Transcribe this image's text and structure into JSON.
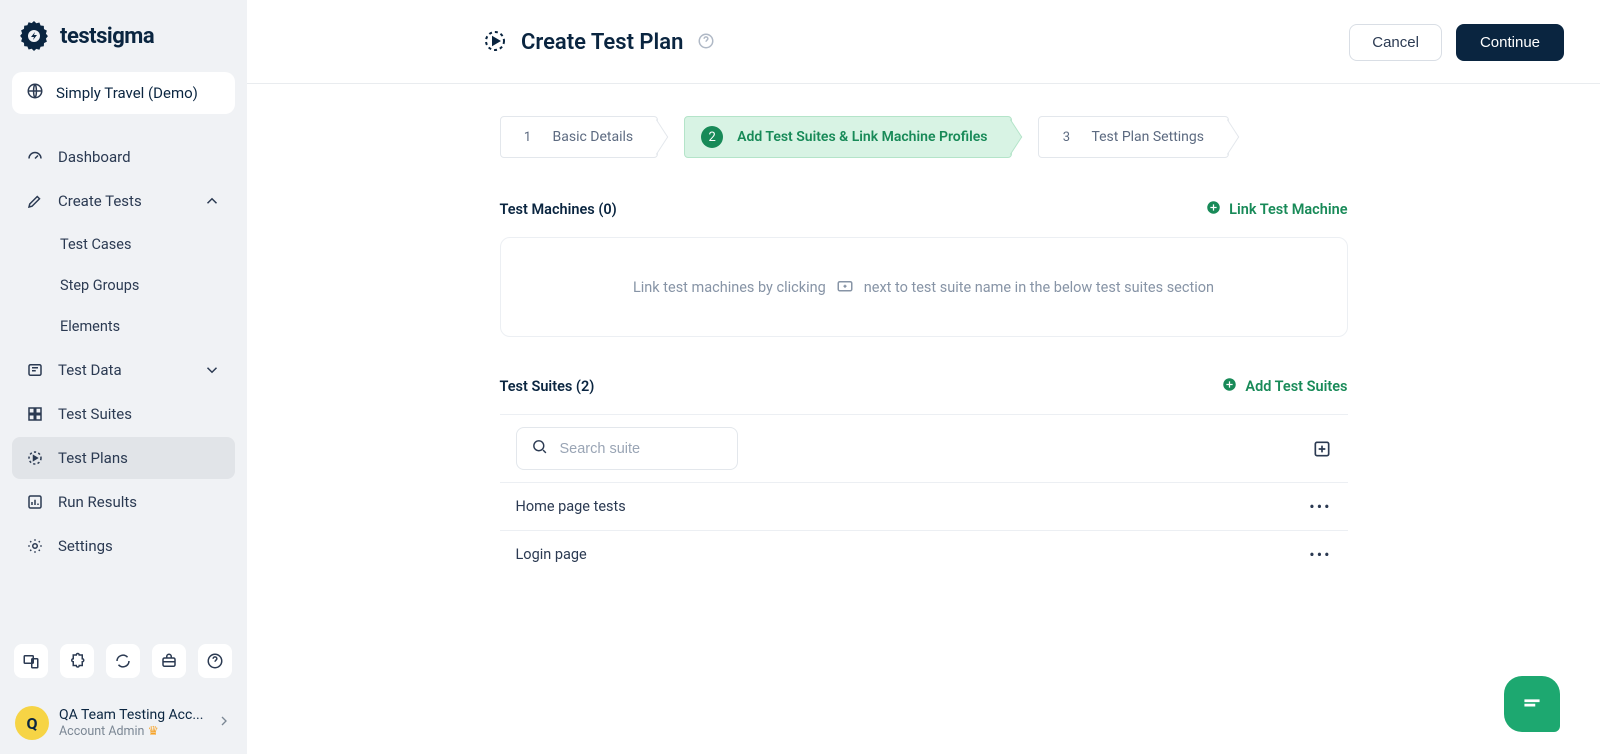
{
  "brand": {
    "name": "testsigma"
  },
  "project": {
    "name": "Simply Travel (Demo)"
  },
  "sidebar": {
    "items": [
      {
        "label": "Dashboard"
      },
      {
        "label": "Create Tests"
      },
      {
        "label": "Test Data"
      },
      {
        "label": "Test Suites"
      },
      {
        "label": "Test Plans"
      },
      {
        "label": "Run Results"
      },
      {
        "label": "Settings"
      }
    ],
    "create_tests_sub": [
      {
        "label": "Test Cases"
      },
      {
        "label": "Step Groups"
      },
      {
        "label": "Elements"
      }
    ]
  },
  "account": {
    "avatar_initial": "Q",
    "name": "QA Team Testing Acc...",
    "role": "Account Admin"
  },
  "header": {
    "title": "Create Test Plan",
    "cancel_label": "Cancel",
    "continue_label": "Continue"
  },
  "steps": [
    {
      "num": "1",
      "label": "Basic Details"
    },
    {
      "num": "2",
      "label": "Add Test Suites & Link Machine Profiles"
    },
    {
      "num": "3",
      "label": "Test Plan Settings"
    }
  ],
  "machines": {
    "title": "Test Machines (0)",
    "action_label": "Link Test Machine",
    "empty_text_before": "Link test machines by clicking",
    "empty_text_after": "next to test suite name in the below test suites section"
  },
  "suites": {
    "title": "Test Suites (2)",
    "action_label": "Add Test Suites",
    "search_placeholder": "Search suite",
    "items": [
      {
        "name": "Home page tests"
      },
      {
        "name": "Login page"
      }
    ]
  }
}
